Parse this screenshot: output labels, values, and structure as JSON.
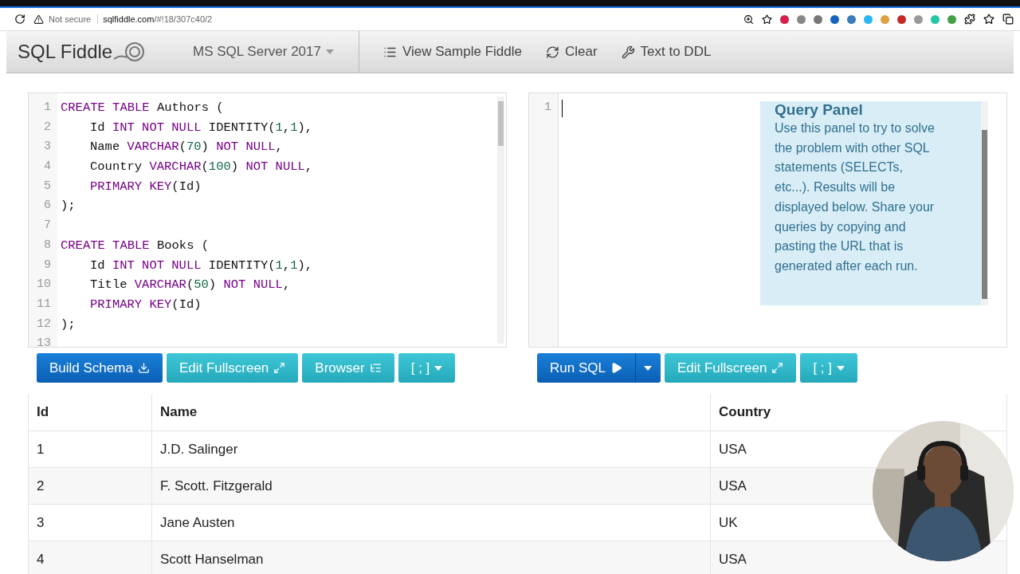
{
  "browser": {
    "security": "Not secure",
    "url_host": "sqlfiddle.com",
    "url_path": "/#!18/307c40/2"
  },
  "navbar": {
    "brand": "SQL Fiddle",
    "database": "MS SQL Server 2017",
    "links": [
      "View Sample Fiddle",
      "Clear",
      "Text to DDL"
    ]
  },
  "schema_editor": {
    "lines": [
      {
        "number": "1",
        "indented": false,
        "tokens": [
          {
            "kind": "keyword",
            "t": "CREATE TABLE"
          },
          {
            "kind": "plain",
            "t": " Authors ("
          }
        ]
      },
      {
        "number": "2",
        "indented": true,
        "tokens": [
          {
            "kind": "plain",
            "t": "Id "
          },
          {
            "kind": "keyword",
            "t": "INT NOT NULL"
          },
          {
            "kind": "plain",
            "t": " IDENTITY("
          },
          {
            "kind": "number",
            "t": "1"
          },
          {
            "kind": "plain",
            "t": ","
          },
          {
            "kind": "number",
            "t": "1"
          },
          {
            "kind": "plain",
            "t": "),"
          }
        ]
      },
      {
        "number": "3",
        "indented": true,
        "tokens": [
          {
            "kind": "plain",
            "t": "Name "
          },
          {
            "kind": "keyword",
            "t": "VARCHAR"
          },
          {
            "kind": "plain",
            "t": "("
          },
          {
            "kind": "number",
            "t": "70"
          },
          {
            "kind": "plain",
            "t": ") "
          },
          {
            "kind": "keyword",
            "t": "NOT NULL"
          },
          {
            "kind": "plain",
            "t": ","
          }
        ]
      },
      {
        "number": "4",
        "indented": true,
        "tokens": [
          {
            "kind": "plain",
            "t": "Country "
          },
          {
            "kind": "keyword",
            "t": "VARCHAR"
          },
          {
            "kind": "plain",
            "t": "("
          },
          {
            "kind": "number",
            "t": "100"
          },
          {
            "kind": "plain",
            "t": ") "
          },
          {
            "kind": "keyword",
            "t": "NOT NULL"
          },
          {
            "kind": "plain",
            "t": ","
          }
        ]
      },
      {
        "number": "5",
        "indented": true,
        "tokens": [
          {
            "kind": "keyword",
            "t": "PRIMARY KEY"
          },
          {
            "kind": "plain",
            "t": "(Id)"
          }
        ]
      },
      {
        "number": "6",
        "indented": false,
        "tokens": [
          {
            "kind": "plain",
            "t": ");"
          }
        ]
      },
      {
        "number": "7"
      },
      {
        "number": "8",
        "indented": false,
        "tokens": [
          {
            "kind": "keyword",
            "t": "CREATE TABLE"
          },
          {
            "kind": "plain",
            "t": " Books ("
          }
        ]
      },
      {
        "number": "9",
        "indented": true,
        "tokens": [
          {
            "kind": "plain",
            "t": "Id "
          },
          {
            "kind": "keyword",
            "t": "INT NOT NULL"
          },
          {
            "kind": "plain",
            "t": " IDENTITY("
          },
          {
            "kind": "number",
            "t": "1"
          },
          {
            "kind": "plain",
            "t": ","
          },
          {
            "kind": "number",
            "t": "1"
          },
          {
            "kind": "plain",
            "t": "),"
          }
        ]
      },
      {
        "number": "10",
        "indented": true,
        "tokens": [
          {
            "kind": "plain",
            "t": "Title "
          },
          {
            "kind": "keyword",
            "t": "VARCHAR"
          },
          {
            "kind": "plain",
            "t": "("
          },
          {
            "kind": "number",
            "t": "50"
          },
          {
            "kind": "plain",
            "t": ") "
          },
          {
            "kind": "keyword",
            "t": "NOT NULL"
          },
          {
            "kind": "plain",
            "t": ","
          }
        ]
      },
      {
        "number": "11",
        "indented": true,
        "tokens": [
          {
            "kind": "keyword",
            "t": "PRIMARY KEY"
          },
          {
            "kind": "plain",
            "t": "(Id)"
          }
        ]
      },
      {
        "number": "12",
        "indented": false,
        "tokens": [
          {
            "kind": "plain",
            "t": ");"
          }
        ]
      },
      {
        "number": "13"
      }
    ]
  },
  "schema_buttons": [
    {
      "label": "Build Schema",
      "kind": "primary"
    },
    {
      "label": "Edit Fullscreen",
      "kind": "info"
    },
    {
      "label": "Browser",
      "kind": "info"
    },
    {
      "label": "[ ; ]",
      "kind": "info"
    }
  ],
  "query_editor": {
    "lines": [
      "1"
    ],
    "help": {
      "title": "Query Panel",
      "text": "Use this panel to try to solve the problem with other SQL statements (SELECTs, etc...). Results will be displayed below. Share your queries by copying and pasting the URL that is generated after each run."
    }
  },
  "query_buttons": [
    {
      "label": "Run SQL",
      "kind": "primary",
      "split": true
    },
    {
      "label": "Edit Fullscreen",
      "kind": "info",
      "split": false
    },
    {
      "label": "[ ; ]",
      "kind": "info",
      "split": false
    }
  ],
  "results": {
    "columns": [
      "Id",
      "Name",
      "Country"
    ],
    "rows": [
      [
        "1",
        "J.D. Salinger",
        "USA"
      ],
      [
        "2",
        "F. Scott. Fitzgerald",
        "USA"
      ],
      [
        "3",
        "Jane Austen",
        "UK"
      ],
      [
        "4",
        "Scott Hanselman",
        "USA"
      ]
    ]
  }
}
